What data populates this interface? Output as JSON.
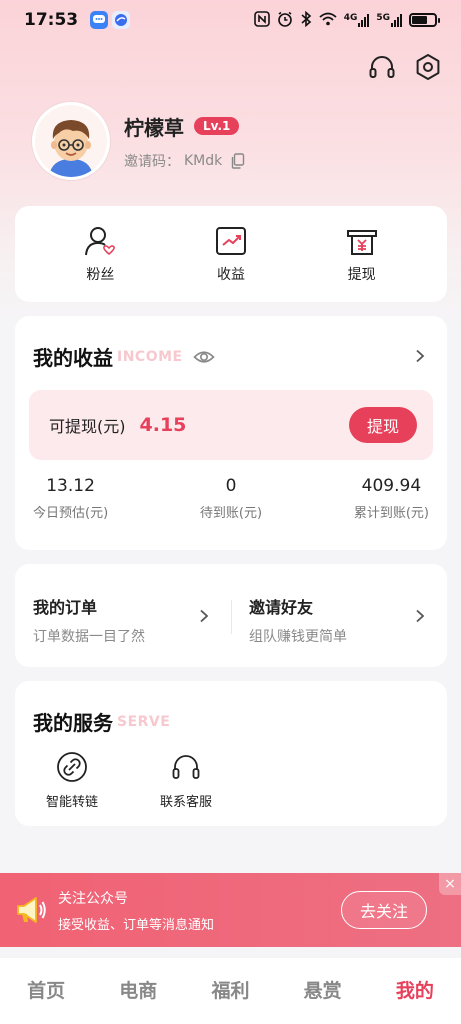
{
  "status_bar": {
    "time": "17:53",
    "net_4g": "4G",
    "net_5g": "5G",
    "battery_level": 0.7
  },
  "colors": {
    "accent": "#e7405a",
    "banner": "#f06274"
  },
  "icons": {
    "top": [
      "headset-icon",
      "settings-hexagon-icon"
    ],
    "quick": [
      "fans-icon",
      "earnings-chart-icon",
      "withdraw-icon"
    ],
    "services": [
      "link-icon",
      "headset-icon"
    ]
  },
  "profile": {
    "name": "柠檬草",
    "level": "Lv.1",
    "invite_label": "邀请码：",
    "invite_code": "KMdk"
  },
  "quick_actions": [
    {
      "label": "粉丝"
    },
    {
      "label": "收益"
    },
    {
      "label": "提现"
    }
  ],
  "income": {
    "title": "我的收益",
    "subtitle": "INCOME",
    "withdrawable_label": "可提现(元)",
    "withdrawable_value": "4.15",
    "withdraw_button": "提现",
    "stats": [
      {
        "value": "13.12",
        "label": "今日预估(元)"
      },
      {
        "value": "0",
        "label": "待到账(元)"
      },
      {
        "value": "409.94",
        "label": "累计到账(元)"
      }
    ]
  },
  "orders": {
    "left": {
      "title": "我的订单",
      "subtitle": "订单数据一目了然"
    },
    "right": {
      "title": "邀请好友",
      "subtitle": "组队赚钱更简单"
    }
  },
  "services": {
    "title": "我的服务",
    "subtitle": "SERVE",
    "items": [
      {
        "label": "智能转链"
      },
      {
        "label": "联系客服"
      }
    ]
  },
  "notify": {
    "title": "关注公众号",
    "subtitle": "接受收益、订单等消息通知",
    "button": "去关注",
    "close": "×"
  },
  "nav": {
    "items": [
      {
        "label": "首页"
      },
      {
        "label": "电商"
      },
      {
        "label": "福利"
      },
      {
        "label": "悬赏"
      },
      {
        "label": "我的"
      }
    ],
    "active_index": 4
  }
}
